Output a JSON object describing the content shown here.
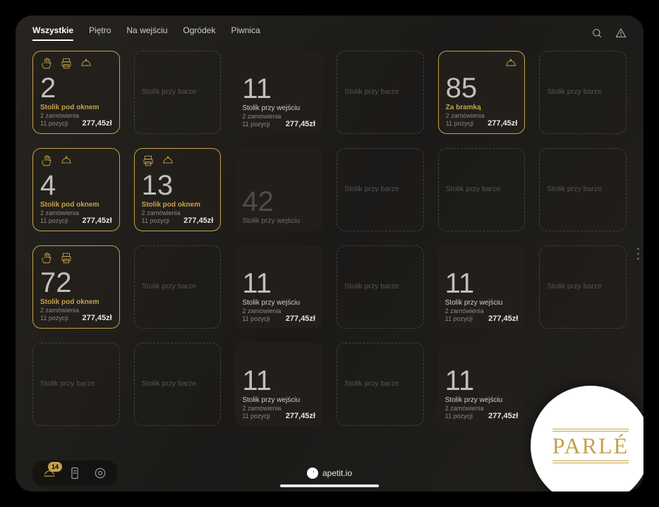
{
  "tabs": [
    "Wszystkie",
    "Piętro",
    "Na wejściu",
    "Ogródek",
    "Piwnica"
  ],
  "active_tab_index": 0,
  "brand": "apetit.io",
  "parle": "PARLÉ",
  "notif_badge": "14",
  "cards": [
    {
      "type": "active",
      "num": "2",
      "name": "Stolik pod oknem",
      "meta1": "2 zamówienia",
      "meta2": "11 pozycji",
      "price": "277,45zł",
      "icons": [
        "hand",
        "printer",
        "cloche"
      ]
    },
    {
      "type": "placeholder",
      "name": "Stolik przy barze"
    },
    {
      "type": "solid",
      "num": "11",
      "name": "Stolik przy wejściu",
      "meta1": "2 zamówienia",
      "meta2": "11 pozycji",
      "price": "277,45zł"
    },
    {
      "type": "placeholder",
      "name": "Stolik przy barze"
    },
    {
      "type": "active",
      "num": "85",
      "name": "Za bramką",
      "meta1": "2 zamówienia",
      "meta2": "11 pozycji",
      "price": "277,45zł",
      "icons_right": [
        "cloche"
      ]
    },
    {
      "type": "placeholder",
      "name": "Stolik przy barze"
    },
    {
      "type": "active",
      "num": "4",
      "name": "Stolik pod oknem",
      "meta1": "2 zamówienia",
      "meta2": "11 pozycji",
      "price": "277,45zł",
      "icons": [
        "hand",
        "",
        "cloche"
      ]
    },
    {
      "type": "active",
      "num": "13",
      "name": "Stolik pod oknem",
      "meta1": "2 zamówienia",
      "meta2": "11 pozycji",
      "price": "277,45zł",
      "icons": [
        "",
        "printer",
        "cloche"
      ]
    },
    {
      "type": "solid dim",
      "num": "42",
      "name": "Stolik przy wejściu"
    },
    {
      "type": "placeholder",
      "name": "Stolik przy barze"
    },
    {
      "type": "placeholder",
      "name": "Stolik przy barze"
    },
    {
      "type": "placeholder",
      "name": "Stolik przy barze"
    },
    {
      "type": "active",
      "num": "72",
      "name": "Stolik pod oknem",
      "meta1": "2 zamówienia",
      "meta2": "11 pozycji",
      "price": "277,45zł",
      "icons": [
        "hand",
        "printer",
        ""
      ]
    },
    {
      "type": "placeholder",
      "name": "Stolik przy barze"
    },
    {
      "type": "solid",
      "num": "11",
      "name": "Stolik przy wejściu",
      "meta1": "2 zamówienia",
      "meta2": "11 pozycji",
      "price": "277,45zł"
    },
    {
      "type": "placeholder",
      "name": "Stolik przy barze"
    },
    {
      "type": "solid",
      "num": "11",
      "name": "Stolik przy wejściu",
      "meta1": "2 zamówienia",
      "meta2": "11 pozycji",
      "price": "277,45zł"
    },
    {
      "type": "placeholder",
      "name": "Stolik przy barze"
    },
    {
      "type": "placeholder",
      "name": "Stolik przy barze"
    },
    {
      "type": "placeholder",
      "name": "Stolik przy barze"
    },
    {
      "type": "solid",
      "num": "11",
      "name": "Stolik przy wejściu",
      "meta1": "2 zamówienia",
      "meta2": "11 pozycji",
      "price": "277,45zł"
    },
    {
      "type": "placeholder",
      "name": "Stolik przy barze"
    },
    {
      "type": "solid",
      "num": "11",
      "name": "Stolik przy wejściu",
      "meta1": "2 zamówienia",
      "meta2": "11 pozycji",
      "price": "277,45zł"
    },
    {
      "type": "blank"
    }
  ]
}
